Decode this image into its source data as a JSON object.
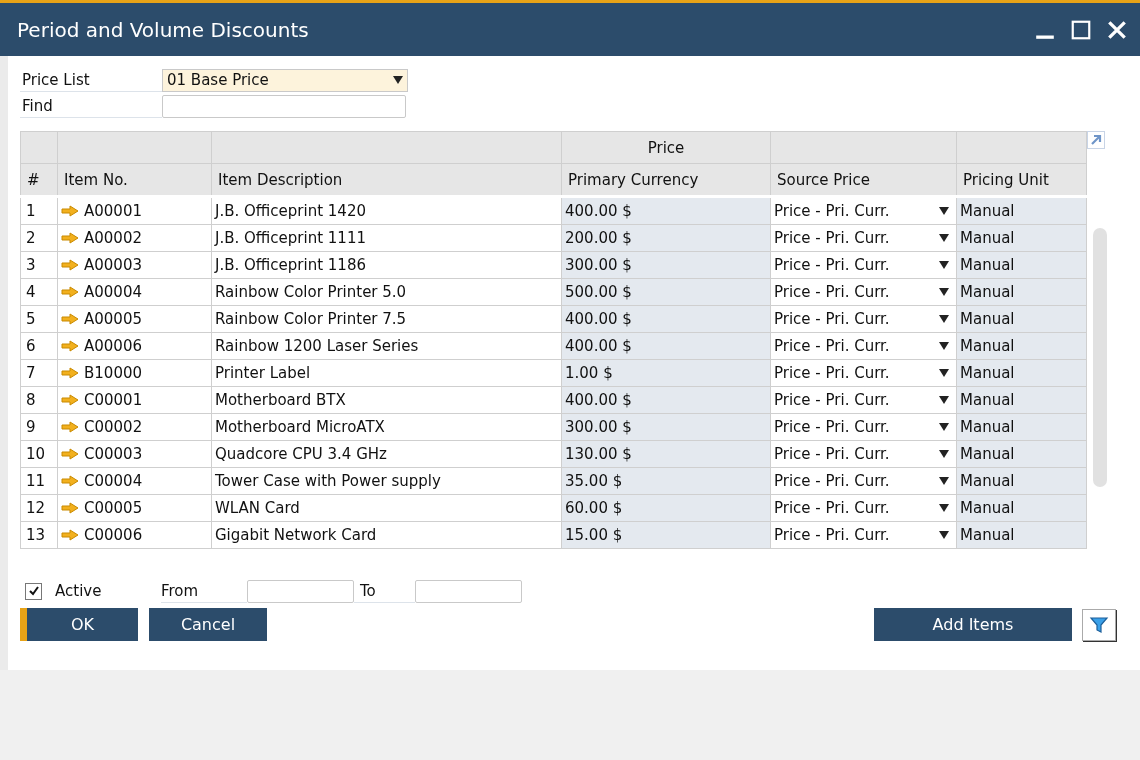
{
  "window": {
    "title": "Period and Volume Discounts"
  },
  "price_list": {
    "label": "Price List",
    "value": "01 Base Price"
  },
  "find": {
    "label": "Find"
  },
  "table": {
    "group_header": "Price",
    "columns": [
      "#",
      "Item No.",
      "Item Description",
      "Primary Currency",
      "Source Price",
      "Pricing Unit"
    ],
    "rows": [
      {
        "num": "1",
        "item_no": "A00001",
        "description": "J.B. Officeprint 1420",
        "price": "400.00 $",
        "source_price": "Price - Pri. Curr.",
        "pricing_unit": "Manual"
      },
      {
        "num": "2",
        "item_no": "A00002",
        "description": "J.B. Officeprint 1111",
        "price": "200.00 $",
        "source_price": "Price - Pri. Curr.",
        "pricing_unit": "Manual"
      },
      {
        "num": "3",
        "item_no": "A00003",
        "description": "J.B. Officeprint 1186",
        "price": "300.00 $",
        "source_price": "Price - Pri. Curr.",
        "pricing_unit": "Manual"
      },
      {
        "num": "4",
        "item_no": "A00004",
        "description": "Rainbow Color Printer 5.0",
        "price": "500.00 $",
        "source_price": "Price - Pri. Curr.",
        "pricing_unit": "Manual"
      },
      {
        "num": "5",
        "item_no": "A00005",
        "description": "Rainbow Color Printer 7.5",
        "price": "400.00 $",
        "source_price": "Price - Pri. Curr.",
        "pricing_unit": "Manual"
      },
      {
        "num": "6",
        "item_no": "A00006",
        "description": "Rainbow 1200 Laser Series",
        "price": "400.00 $",
        "source_price": "Price - Pri. Curr.",
        "pricing_unit": "Manual"
      },
      {
        "num": "7",
        "item_no": "B10000",
        "description": "Printer Label",
        "price": "1.00 $",
        "source_price": "Price - Pri. Curr.",
        "pricing_unit": "Manual"
      },
      {
        "num": "8",
        "item_no": "C00001",
        "description": "Motherboard BTX",
        "price": "400.00 $",
        "source_price": "Price - Pri. Curr.",
        "pricing_unit": "Manual"
      },
      {
        "num": "9",
        "item_no": "C00002",
        "description": "Motherboard MicroATX",
        "price": "300.00 $",
        "source_price": "Price - Pri. Curr.",
        "pricing_unit": "Manual"
      },
      {
        "num": "10",
        "item_no": "C00003",
        "description": "Quadcore CPU 3.4 GHz",
        "price": "130.00 $",
        "source_price": "Price - Pri. Curr.",
        "pricing_unit": "Manual"
      },
      {
        "num": "11",
        "item_no": "C00004",
        "description": "Tower Case with Power supply",
        "price": "35.00 $",
        "source_price": "Price - Pri. Curr.",
        "pricing_unit": "Manual"
      },
      {
        "num": "12",
        "item_no": "C00005",
        "description": "WLAN Card",
        "price": "60.00 $",
        "source_price": "Price - Pri. Curr.",
        "pricing_unit": "Manual"
      },
      {
        "num": "13",
        "item_no": "C00006",
        "description": "Gigabit Network Card",
        "price": "15.00 $",
        "source_price": "Price - Pri. Curr.",
        "pricing_unit": "Manual"
      }
    ]
  },
  "active": {
    "label": "Active",
    "checked": true
  },
  "from": {
    "label": "From"
  },
  "to": {
    "label": "To"
  },
  "buttons": [
    {
      "label": "OK",
      "default": true
    },
    {
      "label": "Cancel",
      "default": false
    }
  ],
  "add_items": {
    "label": "Add Items"
  }
}
